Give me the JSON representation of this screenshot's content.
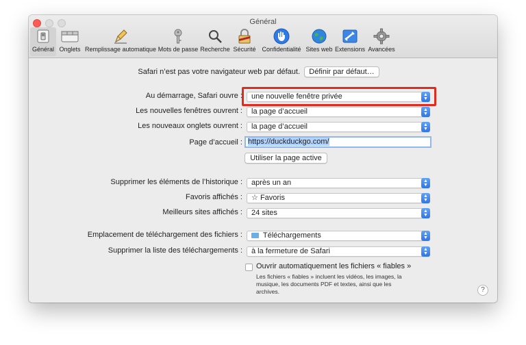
{
  "window": {
    "title": "Général"
  },
  "toolbar": {
    "tabs": [
      {
        "label": "Général",
        "icon": "switch-icon"
      },
      {
        "label": "Onglets",
        "icon": "tabs-icon"
      },
      {
        "label": "Remplissage automatique",
        "icon": "pencil-icon"
      },
      {
        "label": "Mots de passe",
        "icon": "key-icon"
      },
      {
        "label": "Recherche",
        "icon": "magnifier-icon"
      },
      {
        "label": "Sécurité",
        "icon": "padlock-icon"
      },
      {
        "label": "Confidentialité",
        "icon": "hand-icon"
      },
      {
        "label": "Sites web",
        "icon": "globe-icon"
      },
      {
        "label": "Extensions",
        "icon": "puzzle-icon"
      },
      {
        "label": "Avancées",
        "icon": "gear-icon"
      }
    ],
    "selected": "Général"
  },
  "general": {
    "default_browser_text": "Safari n’est pas votre navigateur web par défaut.",
    "default_browser_button": "Définir par défaut…",
    "startup_label": "Au démarrage, Safari ouvre :",
    "startup_value": "une nouvelle fenêtre privée",
    "new_windows_label": "Les nouvelles fenêtres ouvrent :",
    "new_windows_value": "la page d’accueil",
    "new_tabs_label": "Les nouveaux onglets ouvrent :",
    "new_tabs_value": "la page d’accueil",
    "homepage_label": "Page d’accueil :",
    "homepage_value": "https://duckduckgo.com/",
    "use_current_page_button": "Utiliser la page active",
    "history_label": "Supprimer les éléments de l’historique :",
    "history_value": "après un an",
    "favorites_label": "Favoris affichés :",
    "favorites_value": "Favoris",
    "top_sites_label": "Meilleurs sites affichés :",
    "top_sites_value": "24 sites",
    "download_location_label": "Emplacement de téléchargement des fichiers :",
    "download_location_value": "Téléchargements",
    "remove_downloads_label": "Supprimer la liste des téléchargements :",
    "remove_downloads_value": "à la fermeture de Safari",
    "open_safe_files_label": "Ouvrir automatiquement les fichiers « fiables »",
    "open_safe_files_checked": false,
    "safe_files_note_1": "Les fichiers « fiables » incluent les vidéos, les images, la",
    "safe_files_note_2": "musique, les documents PDF et textes, ainsi que les",
    "safe_files_note_3": "archives.",
    "help_button": "?"
  },
  "colors": {
    "accent": "#2f74e6",
    "highlight_box": "#e12b1f",
    "close_button": "#fd5c55"
  }
}
